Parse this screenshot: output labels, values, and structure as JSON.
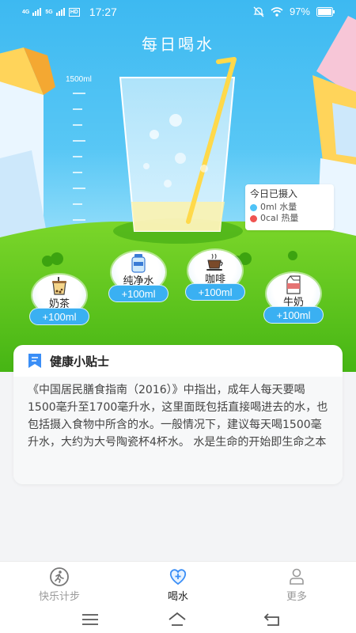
{
  "status_bar": {
    "network_1": "4G",
    "network_2": "5G",
    "hd": "HD",
    "time": "17:27",
    "battery": "97%",
    "icons": [
      "alarm-off-icon",
      "wifi-icon",
      "battery-icon"
    ]
  },
  "title": "每日喝水",
  "scale": {
    "max_label": "1500ml",
    "fill_fraction": 0
  },
  "intake": {
    "heading": "今日已摄入",
    "water": "0ml 水量",
    "calories": "0cal 热量",
    "water_color": "#4fc3f7",
    "calorie_color": "#ef5350"
  },
  "drinks": [
    {
      "name": "奶茶",
      "add": "+100ml",
      "icon": "milk-tea-icon"
    },
    {
      "name": "纯净水",
      "add": "+100ml",
      "icon": "water-bottle-icon"
    },
    {
      "name": "咖啡",
      "add": "+100ml",
      "icon": "coffee-cup-icon"
    },
    {
      "name": "牛奶",
      "add": "+100ml",
      "icon": "milk-carton-icon"
    }
  ],
  "tips": {
    "title": "健康小贴士",
    "body": "《中国居民膳食指南（2016）》中指出，成年人每天要喝1500毫升至1700毫升水，这里面既包括直接喝进去的水，也包括摄入食物中所含的水。一般情况下，建议每天喝1500毫升水，大约为大号陶瓷杯4杯水。 水是生命的开始即生命之本"
  },
  "tabs": [
    {
      "label": "快乐计步",
      "icon": "running-icon",
      "active": false
    },
    {
      "label": "喝水",
      "icon": "heart-plus-icon",
      "active": true
    },
    {
      "label": "更多",
      "icon": "user-icon",
      "active": false
    }
  ],
  "colors": {
    "accent": "#3ab0f2",
    "sky": "#3db9f1",
    "grass": "#56c414"
  }
}
